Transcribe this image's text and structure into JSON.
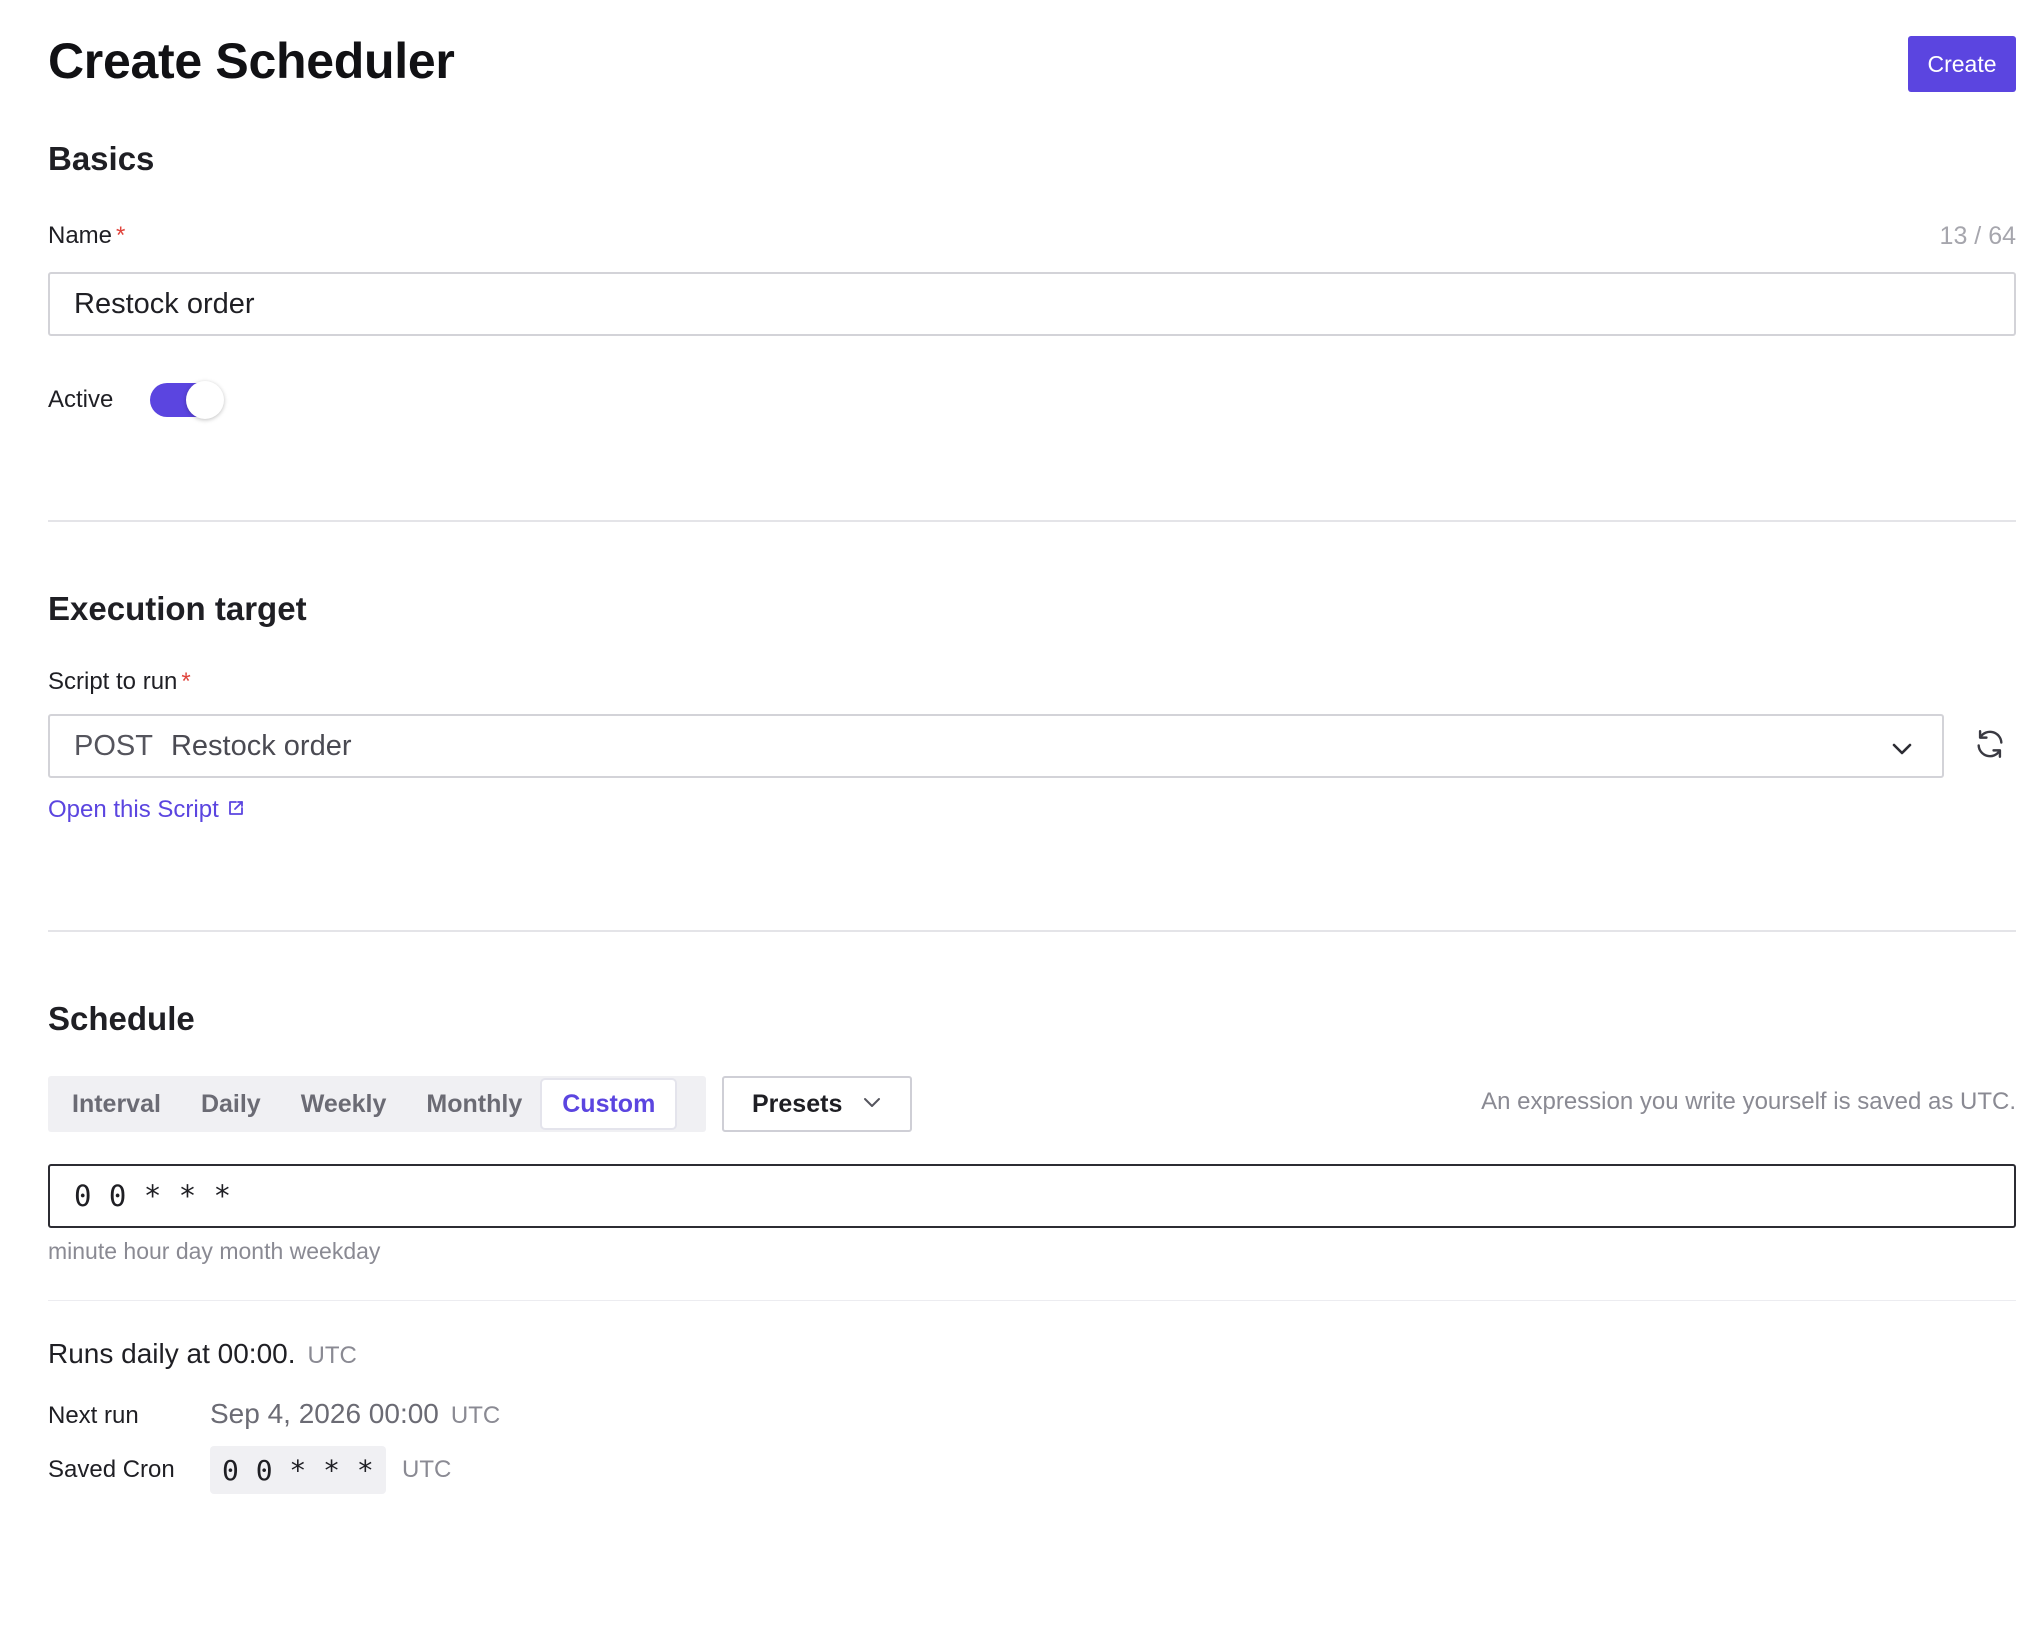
{
  "header": {
    "title": "Create Scheduler",
    "create_label": "Create"
  },
  "basics": {
    "title": "Basics",
    "name_label": "Name",
    "required_mark": "*",
    "name_value": "Restock order",
    "name_counter": "13 / 64",
    "active_label": "Active",
    "active": true
  },
  "execution": {
    "title": "Execution target",
    "script_label": "Script to run",
    "required_mark": "*",
    "script_method": "POST",
    "script_name": "Restock order",
    "open_link": "Open this Script"
  },
  "schedule": {
    "title": "Schedule",
    "tabs": [
      "Interval",
      "Daily",
      "Weekly",
      "Monthly",
      "Custom"
    ],
    "active_tab": "Custom",
    "presets_label": "Presets",
    "utc_note": "An expression you write yourself is saved as UTC.",
    "cron_value": "0 0 * * *",
    "cron_hint": "minute hour day month weekday",
    "summary_text": "Runs daily at 00:00.",
    "summary_tz": "UTC",
    "next_run_label": "Next run",
    "next_run_value": "Sep 4, 2026 00:00",
    "next_run_tz": "UTC",
    "saved_cron_label": "Saved Cron",
    "saved_cron_value": "0 0 * * *",
    "saved_cron_tz": "UTC"
  },
  "colors": {
    "accent": "#5b45e0",
    "required": "#e0443c",
    "muted": "#8a8a93"
  },
  "icons": {
    "select_chevron": "chevron-down-icon",
    "refresh": "refresh-icon",
    "external_link": "external-link-icon",
    "presets_chevron": "chevron-down-icon"
  }
}
